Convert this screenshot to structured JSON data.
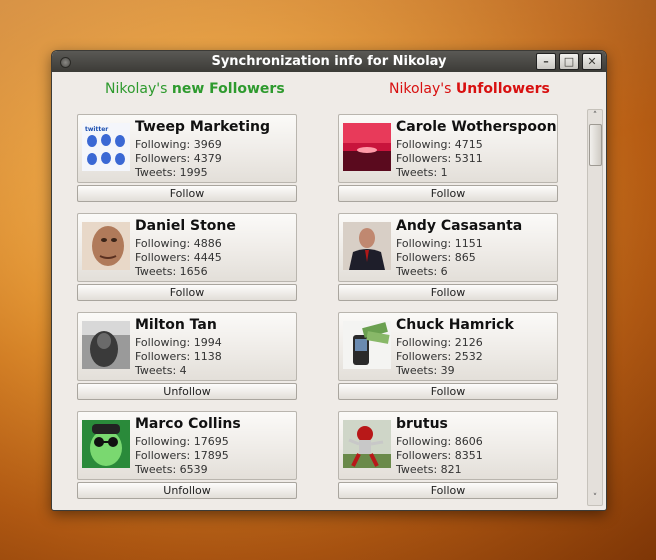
{
  "window": {
    "title": "Synchronization info for Nikolay",
    "menu_dot": "window-menu-icon",
    "minimize": "–",
    "maximize": "□",
    "close": "✕"
  },
  "headers": {
    "new_followers": {
      "owner": "Nikolay's",
      "label": "new Followers"
    },
    "unfollowers": {
      "owner": "Nikolay's",
      "label": "Unfollowers"
    }
  },
  "colors": {
    "new_followers": "#2e9a2e",
    "unfollowers": "#d81010"
  },
  "new_followers": [
    {
      "name": "Tweep Marketing",
      "following": "Following: 3969",
      "followers": "Followers: 4379",
      "tweets": "Tweets: 1995",
      "button": "Follow",
      "avatar": "blue-birds-avatar"
    },
    {
      "name": "Daniel Stone",
      "following": "Following: 4886",
      "followers": "Followers: 4445",
      "tweets": "Tweets: 1656",
      "button": "Follow",
      "avatar": "man-face-avatar"
    },
    {
      "name": "Milton Tan",
      "following": "Following: 1994",
      "followers": "Followers: 1138",
      "tweets": "Tweets: 4",
      "button": "Unfollow",
      "avatar": "bw-photo-avatar"
    },
    {
      "name": "Marco Collins",
      "following": "Following: 17695",
      "followers": "Followers: 17895",
      "tweets": "Tweets: 6539",
      "button": "Unfollow",
      "avatar": "green-glasses-avatar"
    }
  ],
  "unfollowers": [
    {
      "name": "Carole Wotherspoon",
      "following": "Following: 4715",
      "followers": "Followers: 5311",
      "tweets": "Tweets: 1",
      "button": "Follow",
      "avatar": "sunset-avatar"
    },
    {
      "name": "Andy Casasanta",
      "following": "Following: 1151",
      "followers": "Followers: 865",
      "tweets": "Tweets: 6",
      "button": "Follow",
      "avatar": "suit-man-avatar"
    },
    {
      "name": "Chuck Hamrick",
      "following": "Following: 2126",
      "followers": "Followers: 2532",
      "tweets": "Tweets: 39",
      "button": "Follow",
      "avatar": "phone-money-avatar"
    },
    {
      "name": "brutus",
      "following": "Following: 8606",
      "followers": "Followers: 8351",
      "tweets": "Tweets: 821",
      "button": "Follow",
      "avatar": "mascot-avatar"
    }
  ],
  "scrollbar": {
    "up": "˄",
    "down": "˅"
  }
}
